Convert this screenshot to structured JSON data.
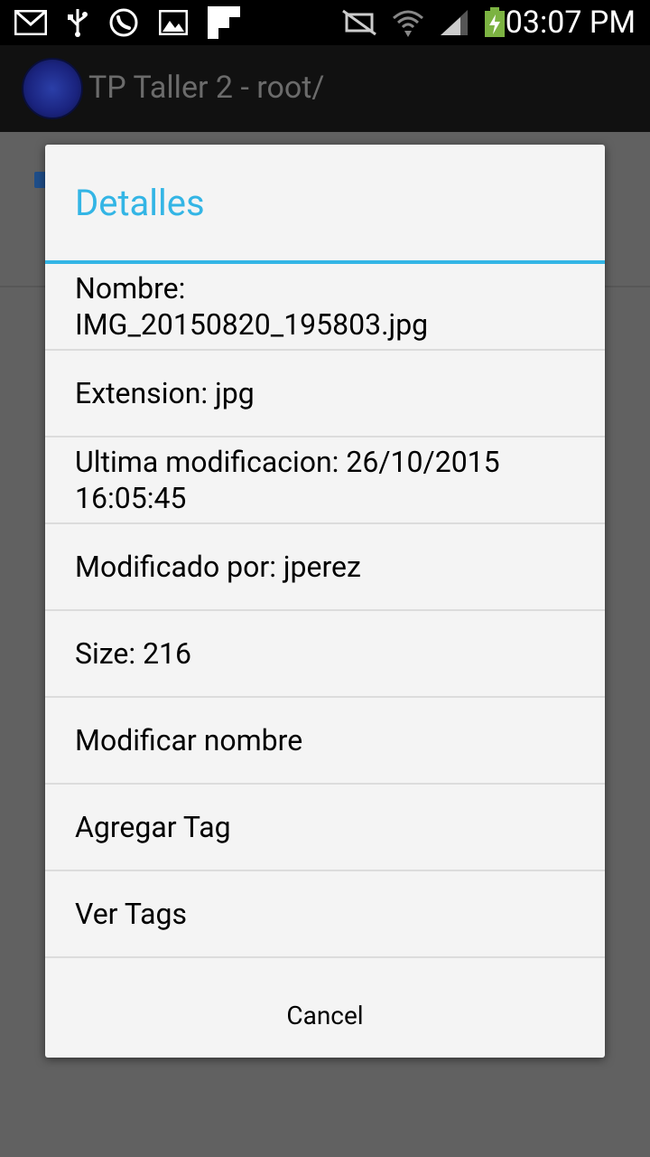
{
  "status_bar": {
    "time": "03:07 PM",
    "icons_left": [
      "mail-icon",
      "usb-icon",
      "whatsapp-icon",
      "image-icon",
      "flipboard-icon"
    ],
    "icons_right": [
      "mute-icon",
      "wifi-icon",
      "signal-icon",
      "battery-icon"
    ]
  },
  "app": {
    "title": "TP Taller 2 - root/"
  },
  "dialog": {
    "title": "Detalles",
    "items": [
      {
        "label": "Nombre:\nIMG_20150820_195803.jpg"
      },
      {
        "label": "Extension: jpg"
      },
      {
        "label": "Ultima modificacion: 26/10/2015\n16:05:45"
      },
      {
        "label": "Modificado por: jperez"
      },
      {
        "label": "Size: 216"
      },
      {
        "label": "Modificar nombre"
      },
      {
        "label": "Agregar Tag"
      },
      {
        "label": "Ver Tags"
      }
    ],
    "cancel_label": "Cancel"
  },
  "colors": {
    "accent": "#33b5e5",
    "dialog_bg": "#f4f4f4",
    "scrim": "#5f5f5f"
  }
}
